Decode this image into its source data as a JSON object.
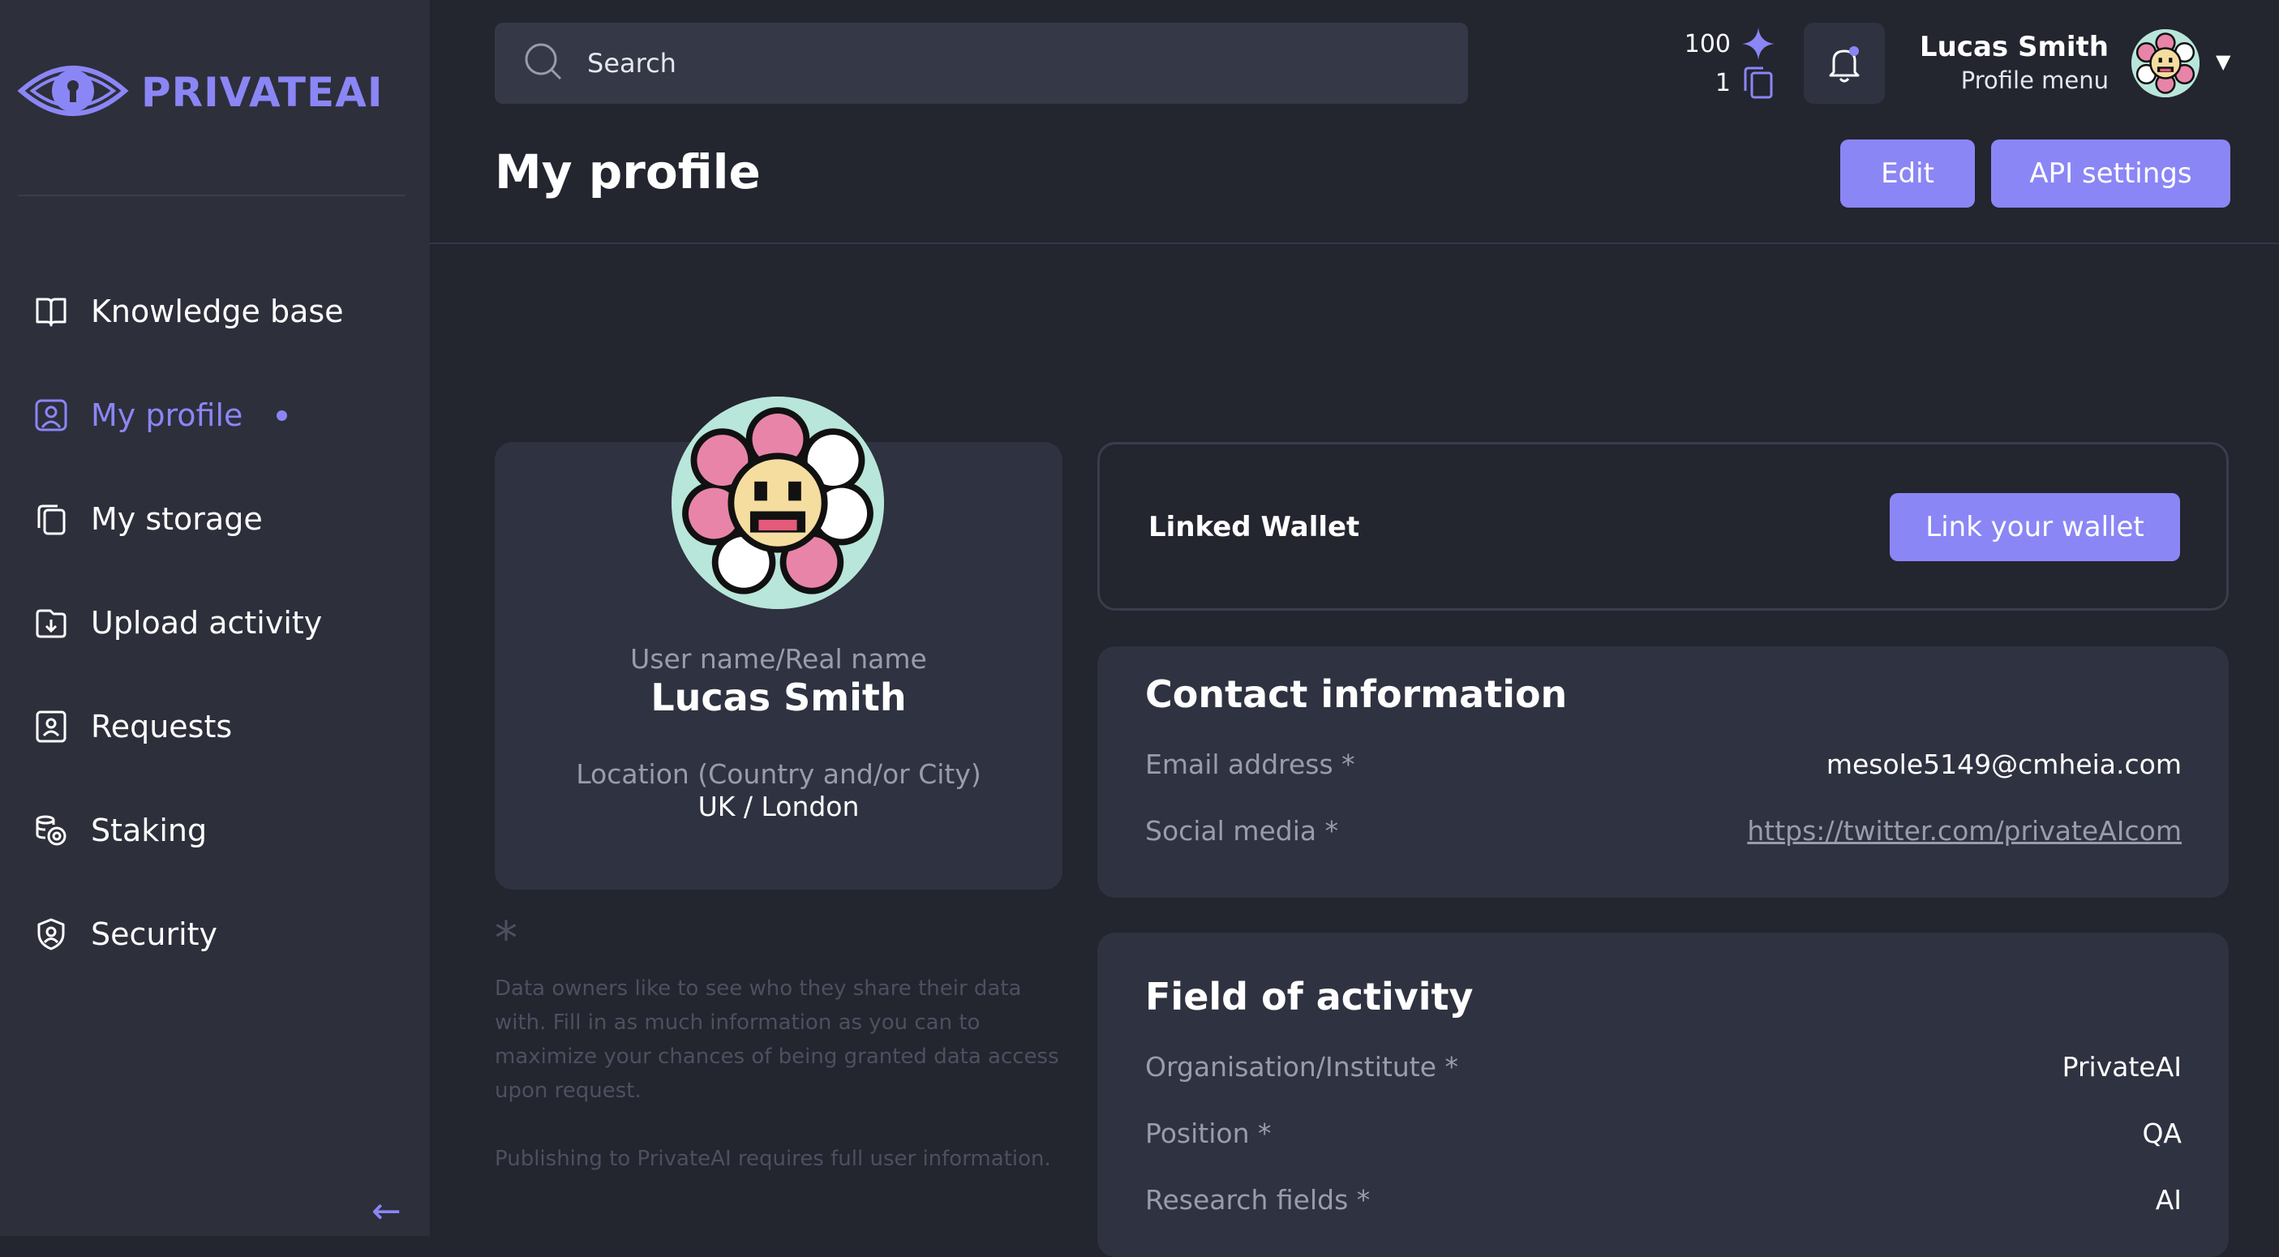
{
  "brand": {
    "name": "PRIVATEAI",
    "accent": "#8b86f5"
  },
  "sidebar": {
    "items": [
      {
        "label": "Knowledge base",
        "icon": "book-icon"
      },
      {
        "label": "My profile",
        "icon": "user-icon",
        "active": true
      },
      {
        "label": "My storage",
        "icon": "copy-icon"
      },
      {
        "label": "Upload activity",
        "icon": "download-box-icon"
      },
      {
        "label": "Requests",
        "icon": "id-card-icon"
      },
      {
        "label": "Staking",
        "icon": "coins-icon"
      },
      {
        "label": "Security",
        "icon": "shield-icon"
      }
    ],
    "collapse_glyph": "←"
  },
  "topbar": {
    "search_placeholder": "Search",
    "points": "100",
    "documents": "1",
    "user_name": "Lucas Smith",
    "profile_menu": "Profile menu"
  },
  "header": {
    "title": "My profile",
    "edit_label": "Edit",
    "api_label": "API settings"
  },
  "profile": {
    "name_label": "User name/Real name",
    "name": "Lucas Smith",
    "location_label": "Location (Country and/or City)",
    "location": "UK / London",
    "note_star": "*",
    "note_text": "Data owners like to see who they share their data with. Fill in as much information as you can to maximize your chances of being granted data access upon request.",
    "note_text2": "Publishing to PrivateAI requires full user information."
  },
  "wallet": {
    "label": "Linked Wallet",
    "button": "Link your wallet"
  },
  "contact": {
    "title": "Contact information",
    "email_label": "Email address *",
    "email": "mesole5149@cmheia.com",
    "social_label": "Social media *",
    "social": "https://twitter.com/privateAIcom"
  },
  "activity": {
    "title": "Field of activity",
    "org_label": "Organisation/Institute *",
    "org": "PrivateAI",
    "position_label": "Position *",
    "position": "QA",
    "research_label": "Research fields *",
    "research": "AI"
  }
}
